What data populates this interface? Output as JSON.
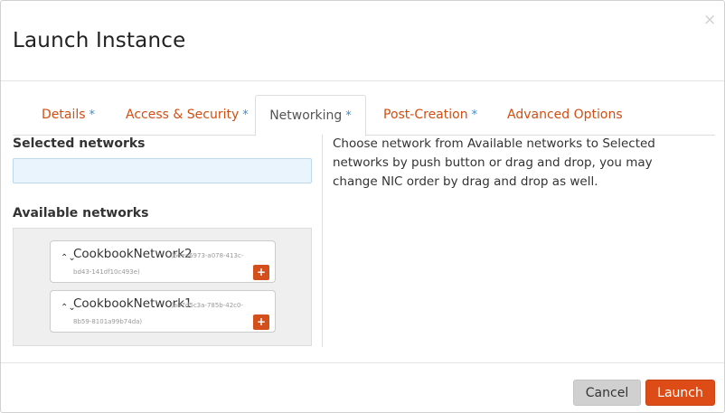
{
  "dialog": {
    "title": "Launch Instance",
    "close_glyph": "×"
  },
  "tabs": [
    {
      "label": "Details",
      "star": "*"
    },
    {
      "label": "Access & Security",
      "star": "*"
    },
    {
      "label": "Networking",
      "star": "*",
      "active": true
    },
    {
      "label": "Post-Creation",
      "star": "*"
    },
    {
      "label": "Advanced Options",
      "star": ""
    }
  ],
  "networking": {
    "selected_label": "Selected networks",
    "available_label": "Available networks",
    "available": [
      {
        "name": "CookbookNetwork2",
        "id_part1": "(6eea6973-a078-413c-",
        "id_part2": "bd43-141df10c493e)",
        "add": "+"
      },
      {
        "name": "CookbookNetwork1",
        "id_part1": "(a87d5c3a-785b-42c0-",
        "id_part2": "8b59-8101a99b74da)",
        "add": "+"
      }
    ],
    "drag_glyph": "⌃⌄",
    "help_text": "Choose network from Available networks to Selected networks by push button or drag and drop, you may change NIC order by drag and drop as well."
  },
  "footer": {
    "cancel_label": "Cancel",
    "launch_label": "Launch"
  },
  "colors": {
    "accent": "#dd4c17",
    "tab_text": "#d24e12",
    "star": "#3a8fcc"
  }
}
